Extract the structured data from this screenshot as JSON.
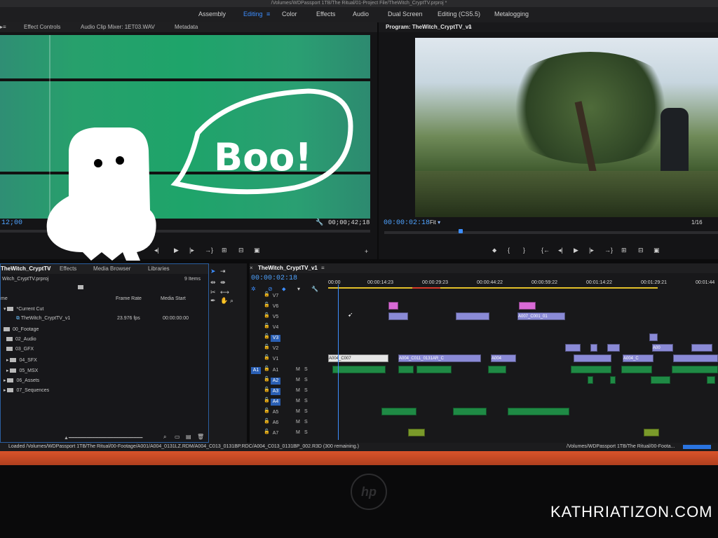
{
  "titlebar": {
    "path": "/Volumes/WDPassport 1TB/The Ritual/01-Project File/TheWitch_CryptTV.prproj *"
  },
  "workspaces": [
    {
      "label": "Assembly"
    },
    {
      "label": "Editing",
      "active": true
    },
    {
      "label": "Color"
    },
    {
      "label": "Effects"
    },
    {
      "label": "Audio"
    },
    {
      "label": "Dual Screen"
    },
    {
      "label": "Editing (CS5.5)"
    },
    {
      "label": "Metalogging"
    }
  ],
  "source_panel": {
    "tabs": [
      "Effect Controls",
      "Audio Clip Mixer: 1ET03.WAV",
      "Metadata"
    ],
    "timecode_left": "12;00",
    "timecode_right": "00;00;42;18"
  },
  "program_panel": {
    "title": "Program: TheWitch_CryptTV_v1",
    "timecode": "00:00:02:18",
    "fit": "Fit",
    "resolution": "1/16"
  },
  "project_panel": {
    "tabs": [
      "TheWitch_CryptTV",
      "Effects",
      "Media Browser",
      "Libraries"
    ],
    "project_file": "Witch_CryptTV.prproj",
    "items_count": "9 Items",
    "columns": [
      "me",
      "Frame Rate",
      "Media Start"
    ],
    "items": [
      {
        "name": "*Current Cut",
        "type": "folder"
      },
      {
        "name": "TheWitch_CryptTV_v1",
        "type": "sequence",
        "frame_rate": "23.976 fps",
        "media_start": "00:00:00:00"
      },
      {
        "name": "00_Footage",
        "type": "folder"
      },
      {
        "name": "02_Audio",
        "type": "folder"
      },
      {
        "name": "03_GFX",
        "type": "folder"
      },
      {
        "name": "04_SFX",
        "type": "folder"
      },
      {
        "name": "05_MSX",
        "type": "folder"
      },
      {
        "name": "06_Assets",
        "type": "folder"
      },
      {
        "name": "07_Sequences",
        "type": "folder"
      }
    ]
  },
  "timeline": {
    "title": "TheWitch_CryptTV_v1",
    "timecode": "00:00:02:18",
    "ruler": [
      "00:00",
      "00:00:14:23",
      "00:00:29:23",
      "00:00:44:22",
      "00:00:59:22",
      "00:01:14:22",
      "00:01:29:21",
      "00:01:44"
    ],
    "video_tracks": [
      "V7",
      "V6",
      "V5",
      "V4",
      "V3",
      "V2",
      "V1"
    ],
    "audio_tracks": [
      "A1",
      "A2",
      "A3",
      "A4",
      "A5",
      "A6",
      "A7"
    ],
    "source_patch": "A1",
    "clip_labels": [
      "A004_C007",
      "A004_C011_0131AR_C",
      "A004",
      "A007_C001_01",
      "A004_C",
      "A00"
    ]
  },
  "status": {
    "left": "Loaded /Volumes/WDPassport 1TB/The Ritual/00-Footage/A001/A004_0131LZ.RDM/A004_C013_0131BP.RDC/A004_C013_0131BP_002.R3D (300 remaining.)",
    "right": "/Volumes/WDPassport 1TB/The Ritual/00-Foota..."
  },
  "doodle": {
    "speech": "Boo!"
  },
  "monitor": {
    "brand": "hp"
  },
  "watermark": "KATHRIATIZON.COM",
  "colors": {
    "accent": "#3d8eff",
    "video_clip": "#8a8ad6",
    "audio_clip": "#1f8a45",
    "pink_clip": "#d96ad6",
    "playhead": "#3d8eff"
  }
}
